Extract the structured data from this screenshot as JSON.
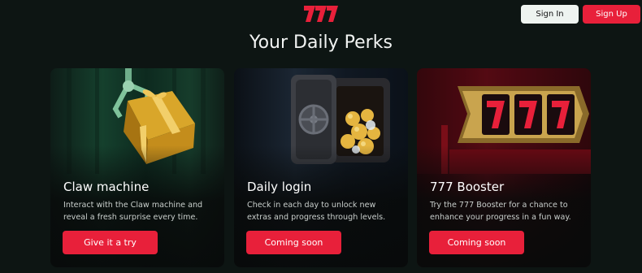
{
  "header": {
    "logo_text": "777",
    "sign_in_label": "Sign In",
    "sign_up_label": "Sign Up"
  },
  "page": {
    "title": "Your Daily Perks"
  },
  "cards": [
    {
      "title": "Claw machine",
      "description": "Interact with the Claw machine and reveal a fresh surprise every time.",
      "button_label": "Give it a try",
      "image_icon": "claw-gift-icon"
    },
    {
      "title": "Daily login",
      "description": "Check in each day to unlock new extras and progress through levels.",
      "button_label": "Coming soon",
      "image_icon": "vault-icon"
    },
    {
      "title": "777 Booster",
      "description": "Try the 777 Booster for a chance to enhance your progress in a fun way.",
      "button_label": "Coming soon",
      "image_icon": "slot-machine-icon"
    }
  ],
  "colors": {
    "accent": "#e8203a",
    "background": "#0d1513"
  }
}
